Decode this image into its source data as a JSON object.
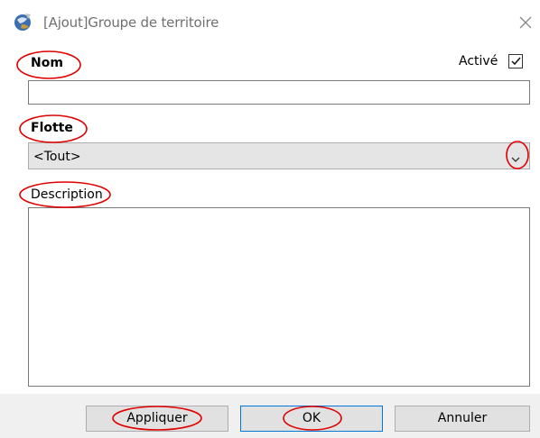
{
  "window": {
    "title": "[Ajout]Groupe de territoire"
  },
  "form": {
    "nom_label": "Nom",
    "nom_value": "",
    "active_label": "Activé",
    "active_checked": true,
    "flotte_label": "Flotte",
    "flotte_selected": "<Tout>",
    "description_label": "Description",
    "description_value": ""
  },
  "buttons": {
    "apply": "Appliquer",
    "ok": "OK",
    "cancel": "Annuler"
  },
  "icons": {
    "app": "app-globe-icon",
    "close": "close-icon",
    "dropdown": "chevron-down-icon",
    "check": "checkmark-icon"
  },
  "colors": {
    "annotation": "#e00000",
    "primary_border": "#0078d7"
  }
}
